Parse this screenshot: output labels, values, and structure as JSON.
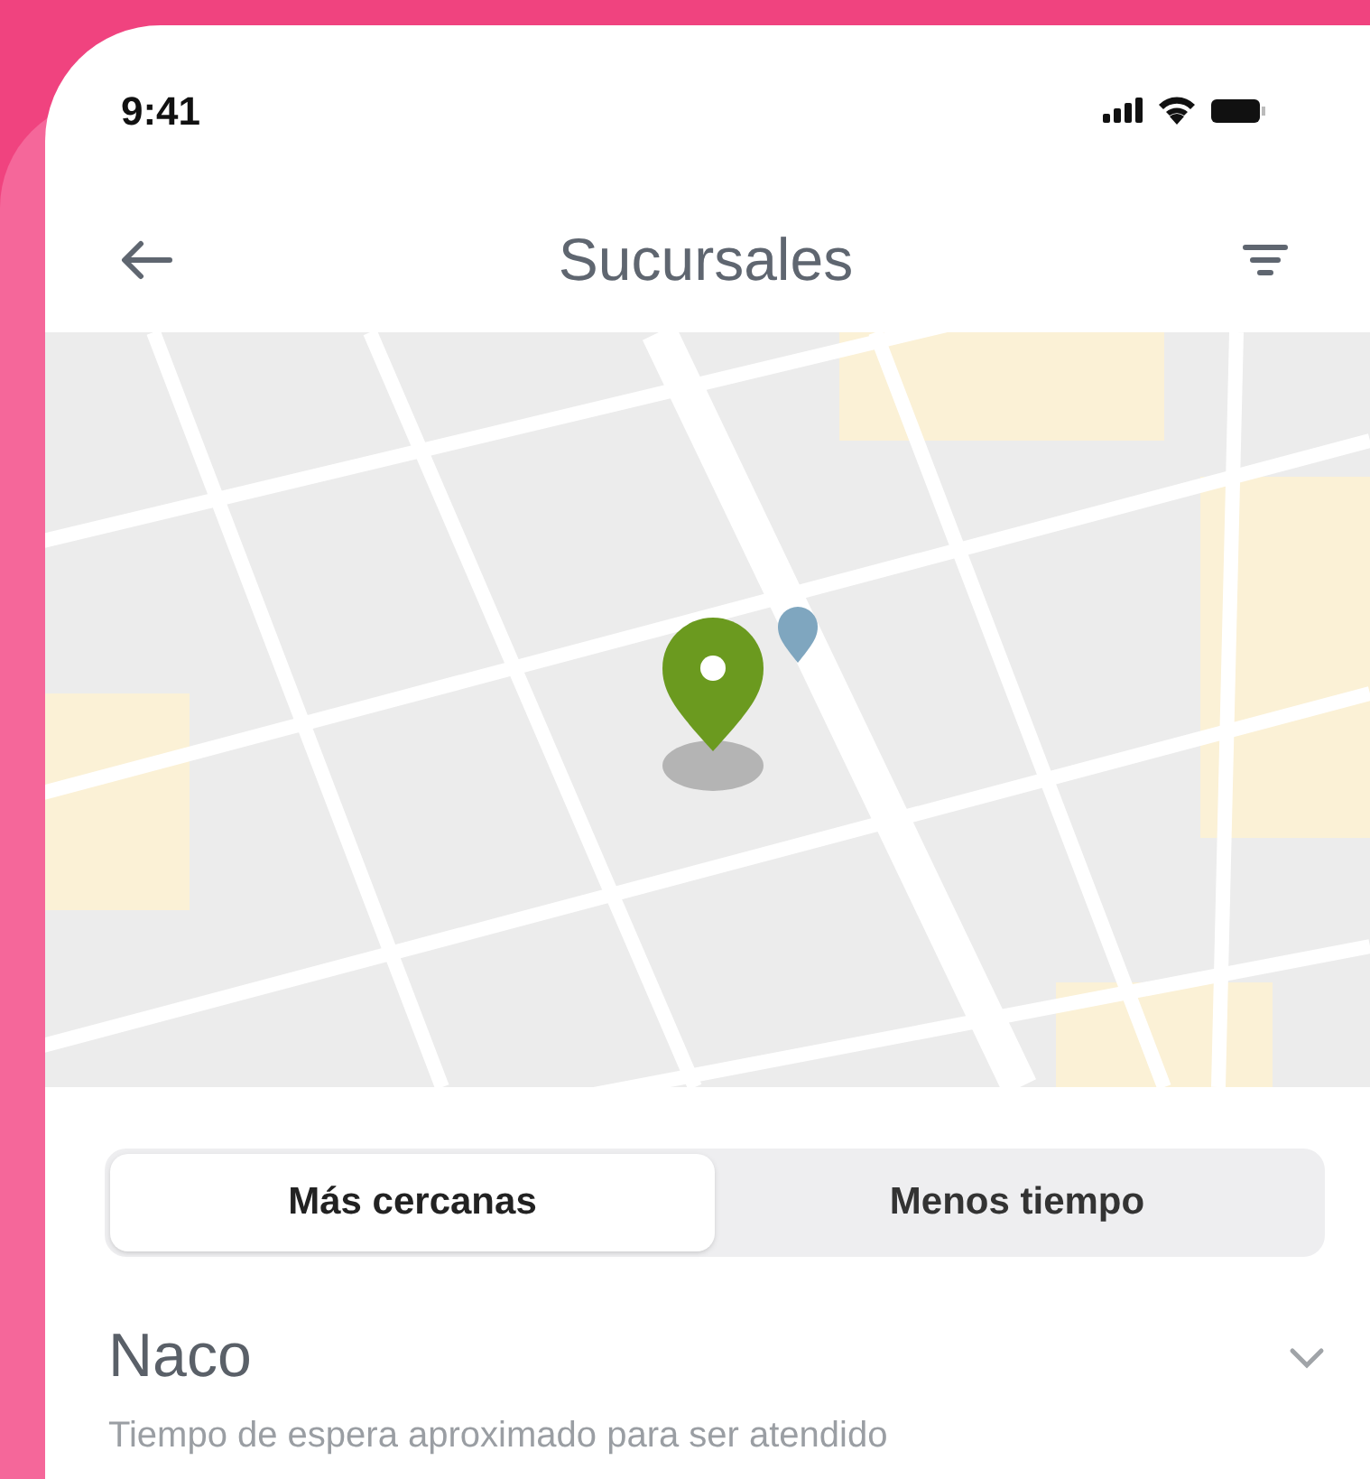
{
  "status_bar": {
    "time": "9:41"
  },
  "header": {
    "title": "Sucursales"
  },
  "segments": [
    {
      "label": "Más cercanas",
      "selected": true
    },
    {
      "label": "Menos tiempo",
      "selected": false
    }
  ],
  "branches": [
    {
      "name": "Naco",
      "subtitle": "Tiempo de espera aproximado para ser atendido",
      "expanded": false
    }
  ]
}
